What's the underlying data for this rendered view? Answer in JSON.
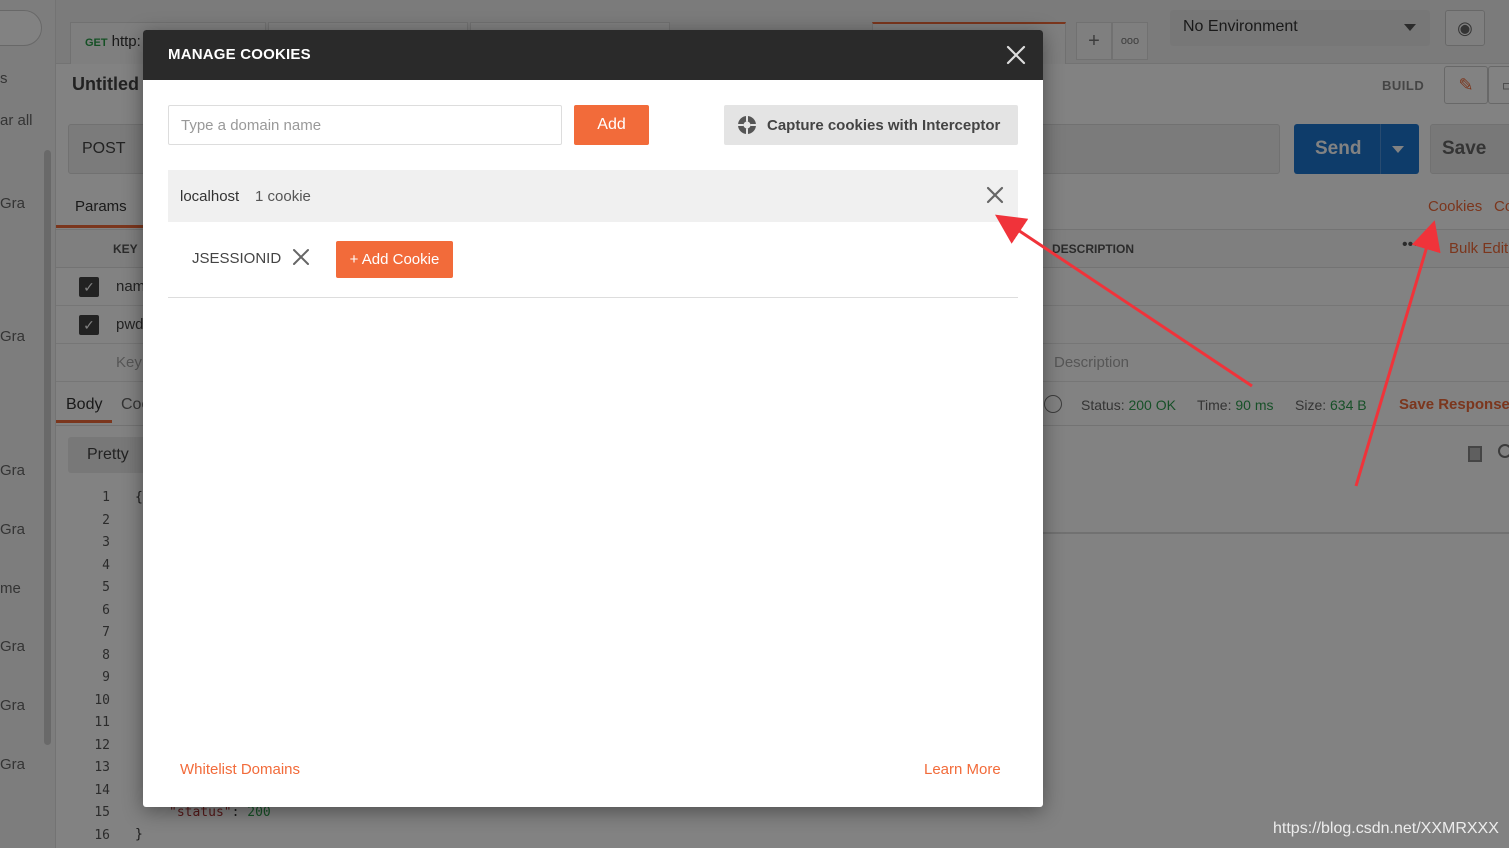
{
  "sidebar": {
    "items": [
      "s",
      "ar all",
      "Gra",
      "Gra",
      "Gra",
      "Gra",
      "me",
      "Gra",
      "Gra",
      "Gra"
    ]
  },
  "tabs": {
    "first_method": "GET",
    "first_url": "http:",
    "more_icon": "ooo"
  },
  "environment": {
    "selected": "No Environment"
  },
  "request": {
    "title": "Untitled",
    "mode": "BUILD",
    "method": "POST",
    "send_label": "Send",
    "save_label": "Save"
  },
  "subtabs": {
    "params": "Params",
    "cookies": "Cookies",
    "code": "Co"
  },
  "params_table": {
    "col_key": "KEY",
    "col_description": "DESCRIPTION",
    "bulk_edit": "Bulk Edit",
    "rows": [
      {
        "key": "nam",
        "checked": true
      },
      {
        "key": "pwd",
        "checked": true
      }
    ],
    "key_placeholder": "Key",
    "desc_placeholder": "Description"
  },
  "response": {
    "body_tab": "Body",
    "cookies_tab": "Coo",
    "status_label": "Status:",
    "status_value": "200 OK",
    "time_label": "Time:",
    "time_value": "90 ms",
    "size_label": "Size:",
    "size_value": "634 B",
    "save_response": "Save Response",
    "view_mode": "Pretty",
    "line_numbers": [
      "1",
      "2",
      "3",
      "4",
      "5",
      "6",
      "7",
      "8",
      "9",
      "10",
      "11",
      "12",
      "13",
      "14",
      "15",
      "16"
    ],
    "code_open": "{",
    "status_key": "\"status\"",
    "status_sep": ":",
    "status_num": "200",
    "code_close": "}"
  },
  "modal": {
    "title": "MANAGE COOKIES",
    "domain_placeholder": "Type a domain name",
    "add_label": "Add",
    "capture_label": "Capture cookies with Interceptor",
    "domains": [
      {
        "name": "localhost",
        "count": "1 cookie",
        "cookies": [
          "JSESSIONID"
        ]
      }
    ],
    "add_cookie_label": "+ Add Cookie",
    "whitelist_label": "Whitelist Domains",
    "learn_more_label": "Learn More"
  },
  "watermark": "https://blog.csdn.net/XXMRXXX",
  "colors": {
    "accent": "#f26b3a",
    "send_blue": "#1c76d1",
    "success_green": "#2e9e4f",
    "arrow_red": "#f0333a",
    "modal_header": "#2a2a2a"
  }
}
